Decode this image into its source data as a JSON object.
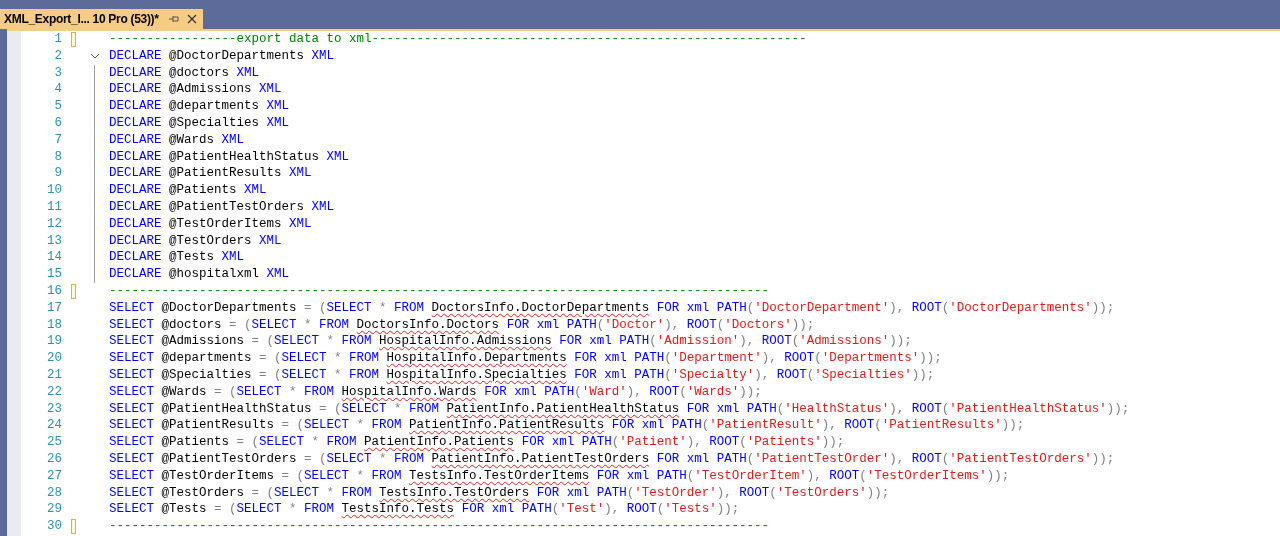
{
  "tab": {
    "title": "XML_Export_I... 10 Pro (53))*",
    "selected": true
  },
  "lines": [
    {
      "number": "1",
      "changed": true,
      "tokens": [
        {
          "kind": "comment",
          "text": "-----------------export data to xml----------------------------------------------------------"
        }
      ]
    },
    {
      "number": "2",
      "changed": false,
      "fold": {
        "expanded": true
      },
      "tokens": [
        {
          "kind": "keyword",
          "text": "DECLARE"
        },
        {
          "kind": "plain",
          "text": " @DoctorDepartments "
        },
        {
          "kind": "keyword",
          "text": "XML"
        }
      ]
    },
    {
      "number": "3",
      "changed": false,
      "tokens": [
        {
          "kind": "keyword",
          "text": "DECLARE"
        },
        {
          "kind": "plain",
          "text": " @doctors "
        },
        {
          "kind": "keyword",
          "text": "XML"
        }
      ]
    },
    {
      "number": "4",
      "changed": false,
      "tokens": [
        {
          "kind": "keyword",
          "text": "DECLARE"
        },
        {
          "kind": "plain",
          "text": " @Admissions "
        },
        {
          "kind": "keyword",
          "text": "XML"
        }
      ]
    },
    {
      "number": "5",
      "changed": false,
      "tokens": [
        {
          "kind": "keyword",
          "text": "DECLARE"
        },
        {
          "kind": "plain",
          "text": " @departments "
        },
        {
          "kind": "keyword",
          "text": "XML"
        }
      ]
    },
    {
      "number": "6",
      "changed": false,
      "tokens": [
        {
          "kind": "keyword",
          "text": "DECLARE"
        },
        {
          "kind": "plain",
          "text": " @Specialties "
        },
        {
          "kind": "keyword",
          "text": "XML"
        }
      ]
    },
    {
      "number": "7",
      "changed": false,
      "tokens": [
        {
          "kind": "keyword",
          "text": "DECLARE"
        },
        {
          "kind": "plain",
          "text": " @Wards "
        },
        {
          "kind": "keyword",
          "text": "XML"
        }
      ]
    },
    {
      "number": "8",
      "changed": false,
      "tokens": [
        {
          "kind": "keyword",
          "text": "DECLARE"
        },
        {
          "kind": "plain",
          "text": " @PatientHealthStatus "
        },
        {
          "kind": "keyword",
          "text": "XML"
        }
      ]
    },
    {
      "number": "9",
      "changed": false,
      "tokens": [
        {
          "kind": "keyword",
          "text": "DECLARE"
        },
        {
          "kind": "plain",
          "text": " @PatientResults "
        },
        {
          "kind": "keyword",
          "text": "XML"
        }
      ]
    },
    {
      "number": "10",
      "changed": false,
      "tokens": [
        {
          "kind": "keyword",
          "text": "DECLARE"
        },
        {
          "kind": "plain",
          "text": " @Patients "
        },
        {
          "kind": "keyword",
          "text": "XML"
        }
      ]
    },
    {
      "number": "11",
      "changed": false,
      "tokens": [
        {
          "kind": "keyword",
          "text": "DECLARE"
        },
        {
          "kind": "plain",
          "text": " @PatientTestOrders "
        },
        {
          "kind": "keyword",
          "text": "XML"
        }
      ]
    },
    {
      "number": "12",
      "changed": false,
      "tokens": [
        {
          "kind": "keyword",
          "text": "DECLARE"
        },
        {
          "kind": "plain",
          "text": " @TestOrderItems "
        },
        {
          "kind": "keyword",
          "text": "XML"
        }
      ]
    },
    {
      "number": "13",
      "changed": false,
      "tokens": [
        {
          "kind": "keyword",
          "text": "DECLARE"
        },
        {
          "kind": "plain",
          "text": " @TestOrders "
        },
        {
          "kind": "keyword",
          "text": "XML"
        }
      ]
    },
    {
      "number": "14",
      "changed": false,
      "tokens": [
        {
          "kind": "keyword",
          "text": "DECLARE"
        },
        {
          "kind": "plain",
          "text": " @Tests "
        },
        {
          "kind": "keyword",
          "text": "XML"
        }
      ]
    },
    {
      "number": "15",
      "changed": false,
      "tokens": [
        {
          "kind": "keyword",
          "text": "DECLARE"
        },
        {
          "kind": "plain",
          "text": " @hospitalxml "
        },
        {
          "kind": "keyword",
          "text": "XML"
        }
      ]
    },
    {
      "number": "16",
      "changed": true,
      "tokens": [
        {
          "kind": "comment",
          "text": "----------------------------------------------------------------------------------------"
        }
      ]
    },
    {
      "number": "17",
      "changed": false,
      "tokens": [
        {
          "kind": "keyword",
          "text": "SELECT"
        },
        {
          "kind": "plain",
          "text": " @DoctorDepartments "
        },
        {
          "kind": "punct",
          "text": "= ("
        },
        {
          "kind": "keyword",
          "text": "SELECT"
        },
        {
          "kind": "punct",
          "text": " * "
        },
        {
          "kind": "keyword",
          "text": "FROM "
        },
        {
          "kind": "unresolved",
          "text": "DoctorsInfo.DoctorDepartments"
        },
        {
          "kind": "keyword",
          "text": " FOR xml PATH"
        },
        {
          "kind": "punct",
          "text": "("
        },
        {
          "kind": "string",
          "text": "'DoctorDepartment'"
        },
        {
          "kind": "punct",
          "text": "), "
        },
        {
          "kind": "keyword",
          "text": "ROOT"
        },
        {
          "kind": "punct",
          "text": "("
        },
        {
          "kind": "string",
          "text": "'DoctorDepartments'"
        },
        {
          "kind": "punct",
          "text": "));"
        }
      ]
    },
    {
      "number": "18",
      "changed": false,
      "tokens": [
        {
          "kind": "keyword",
          "text": "SELECT"
        },
        {
          "kind": "plain",
          "text": " @doctors "
        },
        {
          "kind": "punct",
          "text": "= ("
        },
        {
          "kind": "keyword",
          "text": "SELECT"
        },
        {
          "kind": "punct",
          "text": " * "
        },
        {
          "kind": "keyword",
          "text": "FROM "
        },
        {
          "kind": "unresolved",
          "text": "DoctorsInfo.Doctors"
        },
        {
          "kind": "keyword",
          "text": " FOR xml PATH"
        },
        {
          "kind": "punct",
          "text": "("
        },
        {
          "kind": "string",
          "text": "'Doctor'"
        },
        {
          "kind": "punct",
          "text": "), "
        },
        {
          "kind": "keyword",
          "text": "ROOT"
        },
        {
          "kind": "punct",
          "text": "("
        },
        {
          "kind": "string",
          "text": "'Doctors'"
        },
        {
          "kind": "punct",
          "text": "));"
        }
      ]
    },
    {
      "number": "19",
      "changed": false,
      "tokens": [
        {
          "kind": "keyword",
          "text": "SELECT"
        },
        {
          "kind": "plain",
          "text": " @Admissions "
        },
        {
          "kind": "punct",
          "text": "= ("
        },
        {
          "kind": "keyword",
          "text": "SELECT"
        },
        {
          "kind": "punct",
          "text": " * "
        },
        {
          "kind": "keyword",
          "text": "FROM "
        },
        {
          "kind": "unresolved",
          "text": "HospitalInfo.Admissions"
        },
        {
          "kind": "keyword",
          "text": " FOR xml PATH"
        },
        {
          "kind": "punct",
          "text": "("
        },
        {
          "kind": "string",
          "text": "'Admission'"
        },
        {
          "kind": "punct",
          "text": "), "
        },
        {
          "kind": "keyword",
          "text": "ROOT"
        },
        {
          "kind": "punct",
          "text": "("
        },
        {
          "kind": "string",
          "text": "'Admissions'"
        },
        {
          "kind": "punct",
          "text": "));"
        }
      ]
    },
    {
      "number": "20",
      "changed": false,
      "tokens": [
        {
          "kind": "keyword",
          "text": "SELECT"
        },
        {
          "kind": "plain",
          "text": " @departments "
        },
        {
          "kind": "punct",
          "text": "= ("
        },
        {
          "kind": "keyword",
          "text": "SELECT"
        },
        {
          "kind": "punct",
          "text": " * "
        },
        {
          "kind": "keyword",
          "text": "FROM "
        },
        {
          "kind": "unresolved",
          "text": "HospitalInfo.Departments"
        },
        {
          "kind": "keyword",
          "text": " FOR xml PATH"
        },
        {
          "kind": "punct",
          "text": "("
        },
        {
          "kind": "string",
          "text": "'Department'"
        },
        {
          "kind": "punct",
          "text": "), "
        },
        {
          "kind": "keyword",
          "text": "ROOT"
        },
        {
          "kind": "punct",
          "text": "("
        },
        {
          "kind": "string",
          "text": "'Departments'"
        },
        {
          "kind": "punct",
          "text": "));"
        }
      ]
    },
    {
      "number": "21",
      "changed": false,
      "tokens": [
        {
          "kind": "keyword",
          "text": "SELECT"
        },
        {
          "kind": "plain",
          "text": " @Specialties "
        },
        {
          "kind": "punct",
          "text": "= ("
        },
        {
          "kind": "keyword",
          "text": "SELECT"
        },
        {
          "kind": "punct",
          "text": " * "
        },
        {
          "kind": "keyword",
          "text": "FROM "
        },
        {
          "kind": "unresolved",
          "text": "HospitalInfo.Specialties"
        },
        {
          "kind": "keyword",
          "text": " FOR xml PATH"
        },
        {
          "kind": "punct",
          "text": "("
        },
        {
          "kind": "string",
          "text": "'Specialty'"
        },
        {
          "kind": "punct",
          "text": "), "
        },
        {
          "kind": "keyword",
          "text": "ROOT"
        },
        {
          "kind": "punct",
          "text": "("
        },
        {
          "kind": "string",
          "text": "'Specialties'"
        },
        {
          "kind": "punct",
          "text": "));"
        }
      ]
    },
    {
      "number": "22",
      "changed": false,
      "tokens": [
        {
          "kind": "keyword",
          "text": "SELECT"
        },
        {
          "kind": "plain",
          "text": " @Wards "
        },
        {
          "kind": "punct",
          "text": "= ("
        },
        {
          "kind": "keyword",
          "text": "SELECT"
        },
        {
          "kind": "punct",
          "text": " * "
        },
        {
          "kind": "keyword",
          "text": "FROM "
        },
        {
          "kind": "unresolved",
          "text": "HospitalInfo.Wards"
        },
        {
          "kind": "keyword",
          "text": " FOR xml PATH"
        },
        {
          "kind": "punct",
          "text": "("
        },
        {
          "kind": "string",
          "text": "'Ward'"
        },
        {
          "kind": "punct",
          "text": "), "
        },
        {
          "kind": "keyword",
          "text": "ROOT"
        },
        {
          "kind": "punct",
          "text": "("
        },
        {
          "kind": "string",
          "text": "'Wards'"
        },
        {
          "kind": "punct",
          "text": "));"
        }
      ]
    },
    {
      "number": "23",
      "changed": false,
      "tokens": [
        {
          "kind": "keyword",
          "text": "SELECT"
        },
        {
          "kind": "plain",
          "text": " @PatientHealthStatus "
        },
        {
          "kind": "punct",
          "text": "= ("
        },
        {
          "kind": "keyword",
          "text": "SELECT"
        },
        {
          "kind": "punct",
          "text": " * "
        },
        {
          "kind": "keyword",
          "text": "FROM "
        },
        {
          "kind": "unresolved",
          "text": "PatientInfo.PatientHealthStatus"
        },
        {
          "kind": "keyword",
          "text": " FOR xml PATH"
        },
        {
          "kind": "punct",
          "text": "("
        },
        {
          "kind": "string",
          "text": "'HealthStatus'"
        },
        {
          "kind": "punct",
          "text": "), "
        },
        {
          "kind": "keyword",
          "text": "ROOT"
        },
        {
          "kind": "punct",
          "text": "("
        },
        {
          "kind": "string",
          "text": "'PatientHealthStatus'"
        },
        {
          "kind": "punct",
          "text": "));"
        }
      ]
    },
    {
      "number": "24",
      "changed": false,
      "tokens": [
        {
          "kind": "keyword",
          "text": "SELECT"
        },
        {
          "kind": "plain",
          "text": " @PatientResults "
        },
        {
          "kind": "punct",
          "text": "= ("
        },
        {
          "kind": "keyword",
          "text": "SELECT"
        },
        {
          "kind": "punct",
          "text": " * "
        },
        {
          "kind": "keyword",
          "text": "FROM "
        },
        {
          "kind": "unresolved",
          "text": "PatientInfo.PatientResults"
        },
        {
          "kind": "keyword",
          "text": " FOR xml PATH"
        },
        {
          "kind": "punct",
          "text": "("
        },
        {
          "kind": "string",
          "text": "'PatientResult'"
        },
        {
          "kind": "punct",
          "text": "), "
        },
        {
          "kind": "keyword",
          "text": "ROOT"
        },
        {
          "kind": "punct",
          "text": "("
        },
        {
          "kind": "string",
          "text": "'PatientResults'"
        },
        {
          "kind": "punct",
          "text": "));"
        }
      ]
    },
    {
      "number": "25",
      "changed": false,
      "tokens": [
        {
          "kind": "keyword",
          "text": "SELECT"
        },
        {
          "kind": "plain",
          "text": " @Patients "
        },
        {
          "kind": "punct",
          "text": "= ("
        },
        {
          "kind": "keyword",
          "text": "SELECT"
        },
        {
          "kind": "punct",
          "text": " * "
        },
        {
          "kind": "keyword",
          "text": "FROM "
        },
        {
          "kind": "unresolved",
          "text": "PatientInfo.Patients"
        },
        {
          "kind": "keyword",
          "text": " FOR xml PATH"
        },
        {
          "kind": "punct",
          "text": "("
        },
        {
          "kind": "string",
          "text": "'Patient'"
        },
        {
          "kind": "punct",
          "text": "), "
        },
        {
          "kind": "keyword",
          "text": "ROOT"
        },
        {
          "kind": "punct",
          "text": "("
        },
        {
          "kind": "string",
          "text": "'Patients'"
        },
        {
          "kind": "punct",
          "text": "));"
        }
      ]
    },
    {
      "number": "26",
      "changed": false,
      "tokens": [
        {
          "kind": "keyword",
          "text": "SELECT"
        },
        {
          "kind": "plain",
          "text": " @PatientTestOrders "
        },
        {
          "kind": "punct",
          "text": "= ("
        },
        {
          "kind": "keyword",
          "text": "SELECT"
        },
        {
          "kind": "punct",
          "text": " * "
        },
        {
          "kind": "keyword",
          "text": "FROM "
        },
        {
          "kind": "unresolved",
          "text": "PatientInfo.PatientTestOrders"
        },
        {
          "kind": "keyword",
          "text": " FOR xml PATH"
        },
        {
          "kind": "punct",
          "text": "("
        },
        {
          "kind": "string",
          "text": "'PatientTestOrder'"
        },
        {
          "kind": "punct",
          "text": "), "
        },
        {
          "kind": "keyword",
          "text": "ROOT"
        },
        {
          "kind": "punct",
          "text": "("
        },
        {
          "kind": "string",
          "text": "'PatientTestOrders'"
        },
        {
          "kind": "punct",
          "text": "));"
        }
      ]
    },
    {
      "number": "27",
      "changed": false,
      "tokens": [
        {
          "kind": "keyword",
          "text": "SELECT"
        },
        {
          "kind": "plain",
          "text": " @TestOrderItems "
        },
        {
          "kind": "punct",
          "text": "= ("
        },
        {
          "kind": "keyword",
          "text": "SELECT"
        },
        {
          "kind": "punct",
          "text": " * "
        },
        {
          "kind": "keyword",
          "text": "FROM "
        },
        {
          "kind": "unresolved",
          "text": "TestsInfo.TestOrderItems"
        },
        {
          "kind": "keyword",
          "text": " FOR xml PATH"
        },
        {
          "kind": "punct",
          "text": "("
        },
        {
          "kind": "string",
          "text": "'TestOrderItem'"
        },
        {
          "kind": "punct",
          "text": "), "
        },
        {
          "kind": "keyword",
          "text": "ROOT"
        },
        {
          "kind": "punct",
          "text": "("
        },
        {
          "kind": "string",
          "text": "'TestOrderItems'"
        },
        {
          "kind": "punct",
          "text": "));"
        }
      ]
    },
    {
      "number": "28",
      "changed": false,
      "tokens": [
        {
          "kind": "keyword",
          "text": "SELECT"
        },
        {
          "kind": "plain",
          "text": " @TestOrders "
        },
        {
          "kind": "punct",
          "text": "= ("
        },
        {
          "kind": "keyword",
          "text": "SELECT"
        },
        {
          "kind": "punct",
          "text": " * "
        },
        {
          "kind": "keyword",
          "text": "FROM "
        },
        {
          "kind": "unresolved",
          "text": "TestsInfo.TestOrders"
        },
        {
          "kind": "keyword",
          "text": " FOR xml PATH"
        },
        {
          "kind": "punct",
          "text": "("
        },
        {
          "kind": "string",
          "text": "'TestOrder'"
        },
        {
          "kind": "punct",
          "text": "), "
        },
        {
          "kind": "keyword",
          "text": "ROOT"
        },
        {
          "kind": "punct",
          "text": "("
        },
        {
          "kind": "string",
          "text": "'TestOrders'"
        },
        {
          "kind": "punct",
          "text": "));"
        }
      ]
    },
    {
      "number": "29",
      "changed": false,
      "tokens": [
        {
          "kind": "keyword",
          "text": "SELECT"
        },
        {
          "kind": "plain",
          "text": " @Tests "
        },
        {
          "kind": "punct",
          "text": "= ("
        },
        {
          "kind": "keyword",
          "text": "SELECT"
        },
        {
          "kind": "punct",
          "text": " * "
        },
        {
          "kind": "keyword",
          "text": "FROM "
        },
        {
          "kind": "unresolved",
          "text": "TestsInfo.Tests"
        },
        {
          "kind": "keyword",
          "text": " FOR xml PATH"
        },
        {
          "kind": "punct",
          "text": "("
        },
        {
          "kind": "string",
          "text": "'Test'"
        },
        {
          "kind": "punct",
          "text": "), "
        },
        {
          "kind": "keyword",
          "text": "ROOT"
        },
        {
          "kind": "punct",
          "text": "("
        },
        {
          "kind": "string",
          "text": "'Tests'"
        },
        {
          "kind": "punct",
          "text": "));"
        }
      ]
    },
    {
      "number": "30",
      "changed": true,
      "tokens": [
        {
          "kind": "comment",
          "text": "----------------------------------------------------------------------------------------"
        }
      ]
    }
  ]
}
